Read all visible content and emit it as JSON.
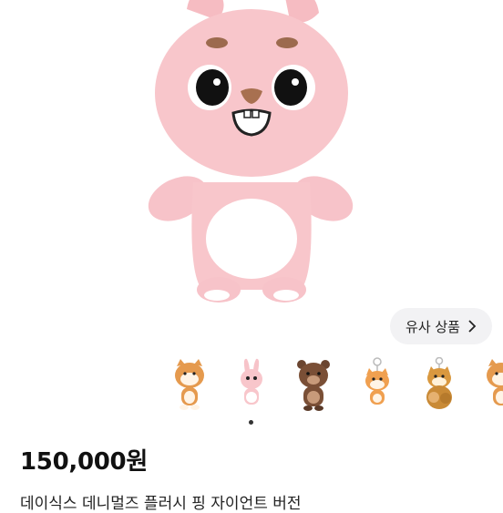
{
  "product": {
    "price": "150,000원",
    "title": "데이식스 데니멀즈 플러시 핑 자이언트 버전"
  },
  "similar_button": {
    "label": "유사 상품",
    "icon": "chevron-right-icon"
  },
  "thumbnails": [
    {
      "icon": "shiba-plush-icon"
    },
    {
      "icon": "bunny-plush-icon"
    },
    {
      "icon": "bear-plush-icon"
    },
    {
      "icon": "fox-keyring-icon"
    },
    {
      "icon": "dog-keyring-icon"
    },
    {
      "icon": "shiba-plush-icon"
    }
  ],
  "carousel": {
    "active_index": 0
  },
  "colors": {
    "plush_pink": "#f8c6cb",
    "belly_white": "#ffffff",
    "button_bg": "#f2f2f4"
  }
}
